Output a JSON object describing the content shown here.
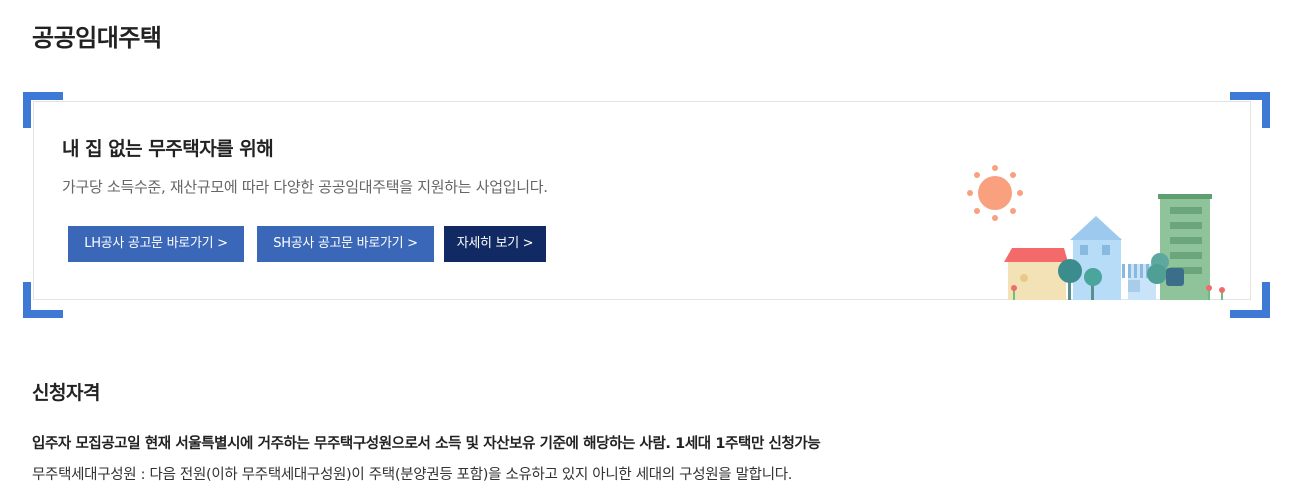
{
  "page": {
    "title": "공공임대주택"
  },
  "banner": {
    "heading": "내 집 없는 무주택자를 위해",
    "description": "가구당 소득수준, 재산규모에 따라 다양한 공공임대주택을 지원하는 사업입니다.",
    "buttons": {
      "lh": "LH공사 공고문 바로가기 >",
      "sh": "SH공사 공고문 바로가기 >",
      "detail": "자세히 보기 >"
    },
    "illustration": "houses-and-sun-illustration"
  },
  "qualification": {
    "title": "신청자격",
    "summary": "입주자 모집공고일 현재 서울특별시에 거주하는 무주택구성원으로서 소득 및 자산보유 기준에 해당하는 사람. 1세대 1주택만 신청가능",
    "definition": "무주택세대구성원 : 다음 전원(이하 무주택세대구성원)이 주택(분양권등 포함)을 소유하고 있지 아니한 세대의 구성원을 말합니다."
  },
  "colors": {
    "accent": "#3f79d6",
    "button_primary": "#3a67b8",
    "button_dark": "#112a64"
  }
}
